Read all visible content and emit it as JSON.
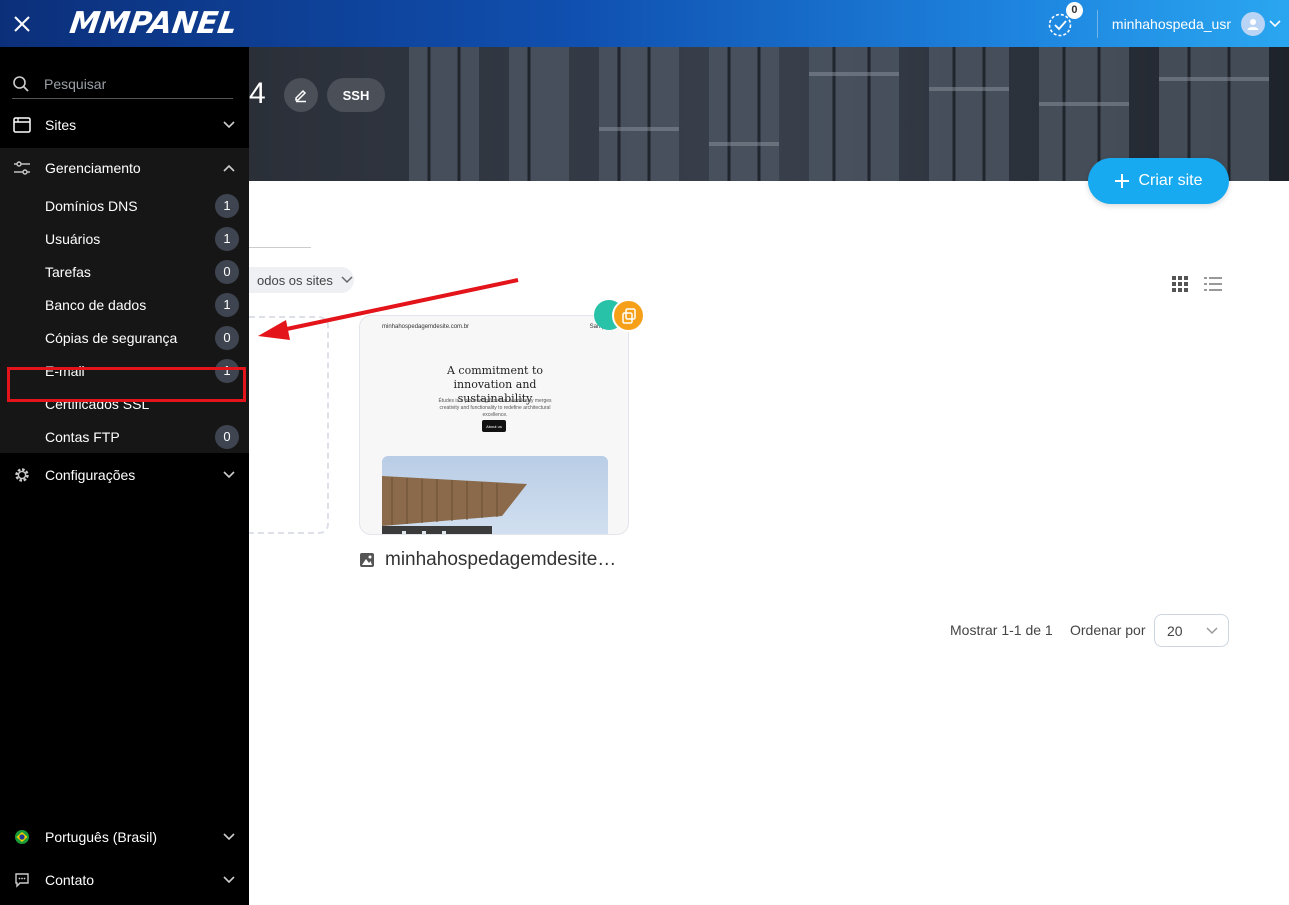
{
  "topbar": {
    "logo": "MMPANEL",
    "tasks_count": "0",
    "username": "minhahospeda_usr"
  },
  "hero": {
    "title_fragment": "4",
    "ssh_label": "SSH",
    "create_label": "Criar site"
  },
  "toolbar": {
    "filter_label": "odos os sites"
  },
  "site_card": {
    "preview_domain": "minhahospedagemdesite.com.br",
    "preview_link": "Sample",
    "preview_heading": "A commitment to innovation and sustainability",
    "preview_text": "Études is a pioneering firm that seamlessly merges creativity and functionality to redefine architectural excellence.",
    "preview_button": "About us",
    "name": "minhahospedagemdesite…"
  },
  "pagination": {
    "showing": "Mostrar 1-1 de 1",
    "order_label": "Ordenar por",
    "order_value": "20"
  },
  "sidebar": {
    "search_placeholder": "Pesquisar",
    "sites": "Sites",
    "management": "Gerenciamento",
    "items": [
      {
        "label": "Domínios DNS",
        "count": "1"
      },
      {
        "label": "Usuários",
        "count": "1"
      },
      {
        "label": "Tarefas",
        "count": "0"
      },
      {
        "label": "Banco de dados",
        "count": "1"
      },
      {
        "label": "Cópias de segurança",
        "count": "0"
      },
      {
        "label": "E-mail",
        "count": "1"
      },
      {
        "label": "Certificados SSL",
        "count": ""
      },
      {
        "label": "Contas FTP",
        "count": "0"
      }
    ],
    "settings": "Configurações",
    "language": "Português (Brasil)",
    "contact": "Contato"
  },
  "colors": {
    "accent": "#18aaf0",
    "highlight": "#e4141b",
    "teal_badge": "#27c2a8",
    "orange_badge": "#f6a01a"
  },
  "icons": [
    "close-icon",
    "task-check-icon",
    "user-avatar-icon",
    "chevron-down-icon",
    "edit-icon",
    "plus-icon",
    "grid-view-icon",
    "list-view-icon",
    "copy-icon",
    "image-icon",
    "search-icon",
    "browser-icon",
    "sliders-icon",
    "gear-icon",
    "brazil-flag-icon",
    "chat-icon"
  ]
}
